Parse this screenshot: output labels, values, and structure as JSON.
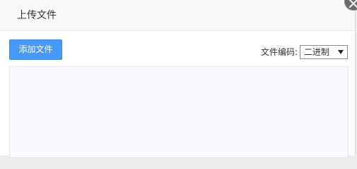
{
  "dialog": {
    "title": "上传文件",
    "close_icon": "close-icon"
  },
  "toolbar": {
    "add_file_label": "添加文件",
    "encoding_label": "文件编码:",
    "encoding_value": "二进制",
    "encoding_options": [
      "二进制"
    ]
  },
  "colors": {
    "primary_button": "#4898f8",
    "header_bg": "#f8f8f8",
    "drop_area_bg": "#f8fafe"
  }
}
